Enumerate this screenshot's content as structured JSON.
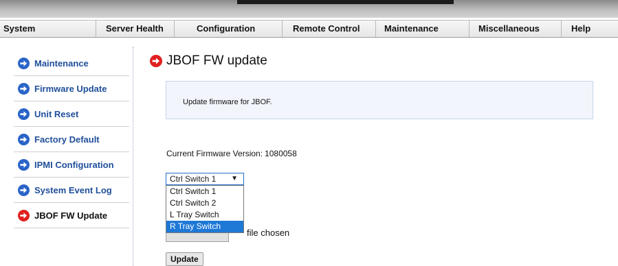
{
  "menu": {
    "items": [
      {
        "label": "System"
      },
      {
        "label": "Server Health"
      },
      {
        "label": "Configuration"
      },
      {
        "label": "Remote Control"
      },
      {
        "label": "Maintenance"
      },
      {
        "label": "Miscellaneous"
      },
      {
        "label": "Help"
      }
    ]
  },
  "sidebar": {
    "items": [
      {
        "label": "Maintenance",
        "icon": "arrow-circle-right-icon"
      },
      {
        "label": "Firmware Update",
        "icon": "arrow-circle-right-icon"
      },
      {
        "label": "Unit Reset",
        "icon": "arrow-circle-right-icon"
      },
      {
        "label": "Factory Default",
        "icon": "arrow-circle-right-icon"
      },
      {
        "label": "IPMI Configuration",
        "icon": "arrow-circle-right-icon"
      },
      {
        "label": "System Event Log",
        "icon": "arrow-circle-right-icon"
      },
      {
        "label": "JBOF FW Update",
        "icon": "arrow-circle-right-icon",
        "active": true
      }
    ]
  },
  "page": {
    "title": "JBOF FW update",
    "info_text": "Update firmware for JBOF.",
    "fw_version_label": "Current Firmware Version:",
    "fw_version_value": "1080058"
  },
  "select": {
    "selected": "Ctrl Switch 1",
    "options": [
      "Ctrl Switch 1",
      "Ctrl Switch 2",
      "L Tray Switch",
      "R Tray Switch"
    ],
    "highlighted_index": 3
  },
  "file": {
    "status_text": "file chosen"
  },
  "actions": {
    "update_label": "Update"
  },
  "colors": {
    "link": "#1f4e9a",
    "icon_blue": "#2a64c8",
    "icon_red": "#e02020",
    "highlight": "#1e78d6",
    "info_bg": "#f2f5fb"
  }
}
